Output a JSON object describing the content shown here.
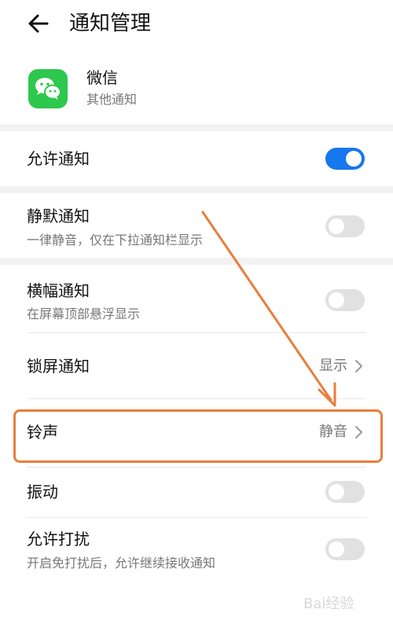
{
  "header": {
    "title": "通知管理",
    "back_icon": "arrow-left-icon"
  },
  "app": {
    "name": "微信",
    "subtitle": "其他通知",
    "icon": "wechat-icon",
    "icon_color": "#2dc84d"
  },
  "settings": {
    "allow_notifications": {
      "label": "允许通知",
      "enabled": true
    },
    "silent_notifications": {
      "label": "静默通知",
      "subtitle": "一律静音，仅在下拉通知栏显示",
      "enabled": false
    },
    "banner_notifications": {
      "label": "横幅通知",
      "subtitle": "在屏幕顶部悬浮显示",
      "enabled": false
    },
    "lockscreen_notifications": {
      "label": "锁屏通知",
      "value": "显示"
    },
    "ringtone": {
      "label": "铃声",
      "value": "静音"
    },
    "vibration": {
      "label": "振动",
      "enabled": false
    },
    "allow_dnd": {
      "label": "允许打扰",
      "subtitle": "开启免打扰后，允许继续接收通知",
      "enabled": false
    }
  },
  "colors": {
    "toggle_on": "#1677ee",
    "toggle_off": "#e1e1e1",
    "annotation": "#e87e3c"
  },
  "watermark": "Bai经验"
}
